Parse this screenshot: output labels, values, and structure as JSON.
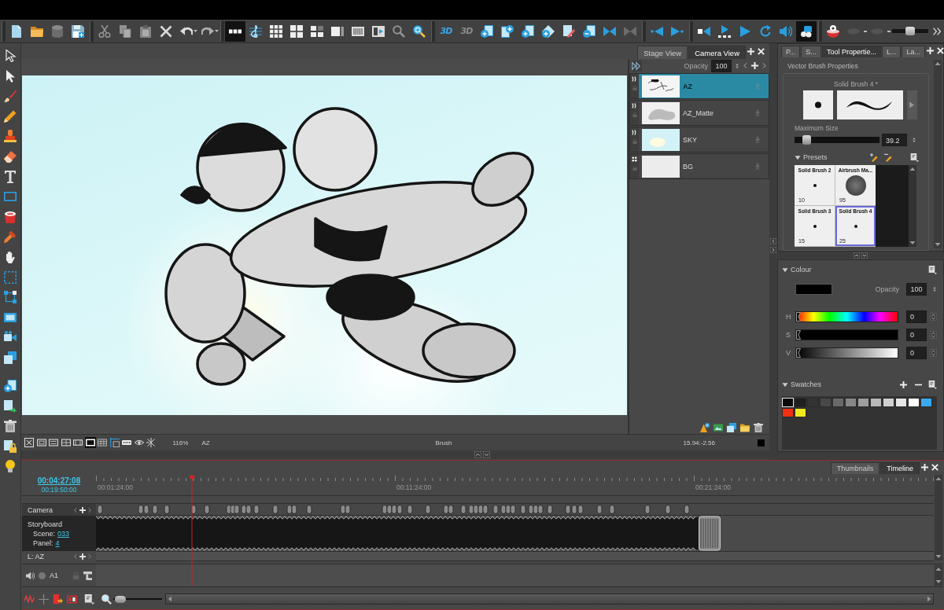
{
  "toolbar": {
    "groups": [
      [
        {
          "selected": false,
          "disabled": false
        },
        {
          "selected": false,
          "disabled": false
        },
        {
          "selected": false,
          "disabled": true
        },
        {
          "selected": false,
          "disabled": false
        }
      ],
      [
        {
          "selected": false,
          "disabled": true
        },
        {
          "selected": false,
          "disabled": true
        },
        {
          "selected": false,
          "disabled": true
        },
        {
          "selected": false,
          "disabled": false
        },
        {
          "selected": false,
          "disabled": false
        },
        {
          "selected": false,
          "disabled": true
        }
      ],
      [
        {
          "selected": true,
          "disabled": false
        },
        {
          "selected": false,
          "disabled": false
        },
        {
          "selected": false,
          "disabled": false
        },
        {
          "selected": false,
          "disabled": false
        },
        {
          "selected": false,
          "disabled": false
        },
        {
          "selected": false,
          "disabled": false
        },
        {
          "selected": false,
          "disabled": false
        },
        {
          "selected": false,
          "disabled": false
        },
        {
          "selected": false,
          "disabled": true
        },
        {
          "selected": false,
          "disabled": false
        }
      ],
      [
        {
          "label": "3D",
          "selected": false,
          "disabled": false
        },
        {
          "label": "3D",
          "selected": false,
          "disabled": true
        },
        {
          "selected": false,
          "disabled": false
        },
        {
          "selected": false,
          "disabled": false
        },
        {
          "selected": false,
          "disabled": false
        },
        {
          "selected": false,
          "disabled": false
        },
        {
          "selected": false,
          "disabled": false
        },
        {
          "selected": false,
          "disabled": false
        },
        {
          "selected": false,
          "disabled": false
        },
        {
          "selected": false,
          "disabled": true
        }
      ],
      [
        {
          "selected": false,
          "disabled": false
        },
        {
          "selected": false,
          "disabled": false
        }
      ],
      [
        {
          "selected": false,
          "disabled": false
        },
        {
          "selected": false,
          "disabled": false
        },
        {
          "selected": false,
          "disabled": false
        },
        {
          "selected": false,
          "disabled": false
        },
        {
          "selected": false,
          "disabled": false
        },
        {
          "selected": true,
          "disabled": false
        }
      ],
      [
        {
          "selected": false,
          "disabled": false
        },
        {
          "selected": false,
          "disabled": true
        },
        {
          "selected": false,
          "disabled": true
        }
      ]
    ],
    "zoom_slider": {
      "level": 0.5
    }
  },
  "view_panel": {
    "tabs": [
      {
        "label": "Stage View",
        "selected": false
      },
      {
        "label": "Camera View",
        "selected": true
      }
    ],
    "layers": {
      "opacity_label": "Opacity",
      "opacity": "100",
      "items": [
        {
          "name": "AZ",
          "kind": "lines",
          "selected": true
        },
        {
          "name": "AZ_Matte",
          "kind": "matte",
          "selected": false
        },
        {
          "name": "SKY",
          "kind": "sky",
          "selected": false
        },
        {
          "name": "BG",
          "kind": "plain",
          "selected": false
        }
      ]
    },
    "view_buttons": [
      {
        "selected": false
      },
      {
        "selected": false
      },
      {
        "selected": false
      },
      {
        "selected": false
      },
      {
        "selected": false
      },
      {
        "selected": true
      },
      {
        "selected": false
      },
      {
        "selected": false
      },
      {
        "selected": false
      },
      {
        "selected": false
      },
      {
        "selected": false
      }
    ],
    "status": {
      "zoom": "116%",
      "layer": "AZ",
      "tool": "Brush",
      "coordinates": "15.94:-2.56"
    }
  },
  "tool_panel": {
    "tabs": [
      {
        "label": "P...",
        "selected": false
      },
      {
        "label": "S...",
        "selected": false
      },
      {
        "label": "Tool Propertie...",
        "selected": true
      },
      {
        "label": "L...",
        "selected": false
      },
      {
        "label": "La...",
        "selected": false
      }
    ],
    "group_title": "Vector Brush Properties",
    "brush_name": "Solid Brush 4 *",
    "size_label": "Maximum Size",
    "size_slider": {
      "level": 0.1
    },
    "size_value": "39.2",
    "presets": {
      "title": "Presets",
      "expanded": true,
      "items": [
        {
          "name": "Solid Brush 2",
          "size": "10",
          "kind": "solid",
          "selected": false
        },
        {
          "name": "Airbrush Ma...",
          "size": "95",
          "kind": "airbrush",
          "selected": false
        },
        {
          "name": "Solid Brush 3",
          "size": "15",
          "kind": "solid",
          "selected": false
        },
        {
          "name": "Solid Brush 4",
          "size": "25",
          "kind": "solid",
          "selected": true
        }
      ]
    }
  },
  "colour_panel": {
    "title": "Colour",
    "expanded": true,
    "opacity_label": "Opacity",
    "opacity": "100",
    "channels": [
      {
        "label": "H",
        "kind": "hue",
        "level": 0,
        "value": "0"
      },
      {
        "label": "S",
        "kind": "saturation",
        "level": 0,
        "value": "0"
      },
      {
        "label": "V",
        "kind": "value",
        "level": 0,
        "value": "0"
      }
    ],
    "swatches": {
      "title": "Swatches",
      "expanded": true,
      "items": [
        {
          "color": "#0a0a0a",
          "selected": true
        },
        {
          "color": "#1f1f1f",
          "selected": false
        },
        {
          "color": "#333333",
          "selected": false
        },
        {
          "color": "#484848",
          "selected": false
        },
        {
          "color": "#696969",
          "selected": false
        },
        {
          "color": "#888888",
          "selected": false
        },
        {
          "color": "#9e9e9e",
          "selected": false
        },
        {
          "color": "#b8b8b8",
          "selected": false
        },
        {
          "color": "#d0d0d0",
          "selected": false
        },
        {
          "color": "#e6e6e6",
          "selected": false
        },
        {
          "color": "#ffffff",
          "selected": false
        },
        {
          "color": "#3aaaf0",
          "selected": false
        },
        {
          "color": "#f03010",
          "selected": false
        },
        {
          "color": "#f0e820",
          "selected": false
        }
      ]
    }
  },
  "timeline": {
    "tabs": [
      {
        "label": "Thumbnails",
        "selected": false
      },
      {
        "label": "Timeline",
        "selected": true
      }
    ],
    "current_time": "00:04:27:08",
    "duration": "00:19:50:00",
    "ruler_labels": [
      "00:01:24:00",
      "00:11:24:00",
      "00:21:24:00"
    ],
    "tracks": {
      "camera": "Camera",
      "storyboard": "Storyboard",
      "scene_label": "Scene:",
      "scene": "033",
      "panel_label": "Panel:",
      "panel": "4",
      "layer": "L: AZ",
      "audio": "A1"
    },
    "zoom_slider": {
      "level": 0.05
    }
  }
}
